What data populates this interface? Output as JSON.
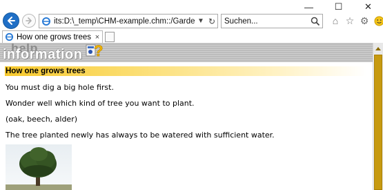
{
  "window": {
    "minimize_glyph": "—",
    "maximize_glyph": "☐",
    "close_glyph": "✕"
  },
  "toolbar": {
    "address": "its:D:\\_temp\\CHM-example.chm::/Garden/tree.htm",
    "search_placeholder": "Suchen...",
    "icons": [
      "home-icon",
      "star-icon",
      "gear-icon",
      "smiley-icon"
    ]
  },
  "tab": {
    "title": "How one grows trees",
    "close_glyph": "×"
  },
  "content": {
    "logo_help": "help",
    "logo_info": "information",
    "heading": "How one grows trees",
    "paragraphs": [
      "You must dig a big hole first.",
      "Wonder well which kind of tree you want to plant.",
      "(oak, beech, alder)",
      "The tree planted newly has always to be watered with sufficient water."
    ]
  },
  "colors": {
    "accent_blue": "#1f6fc6",
    "heading_yellow": "#f7c92c",
    "scroll_thumb": "#c79a10"
  }
}
